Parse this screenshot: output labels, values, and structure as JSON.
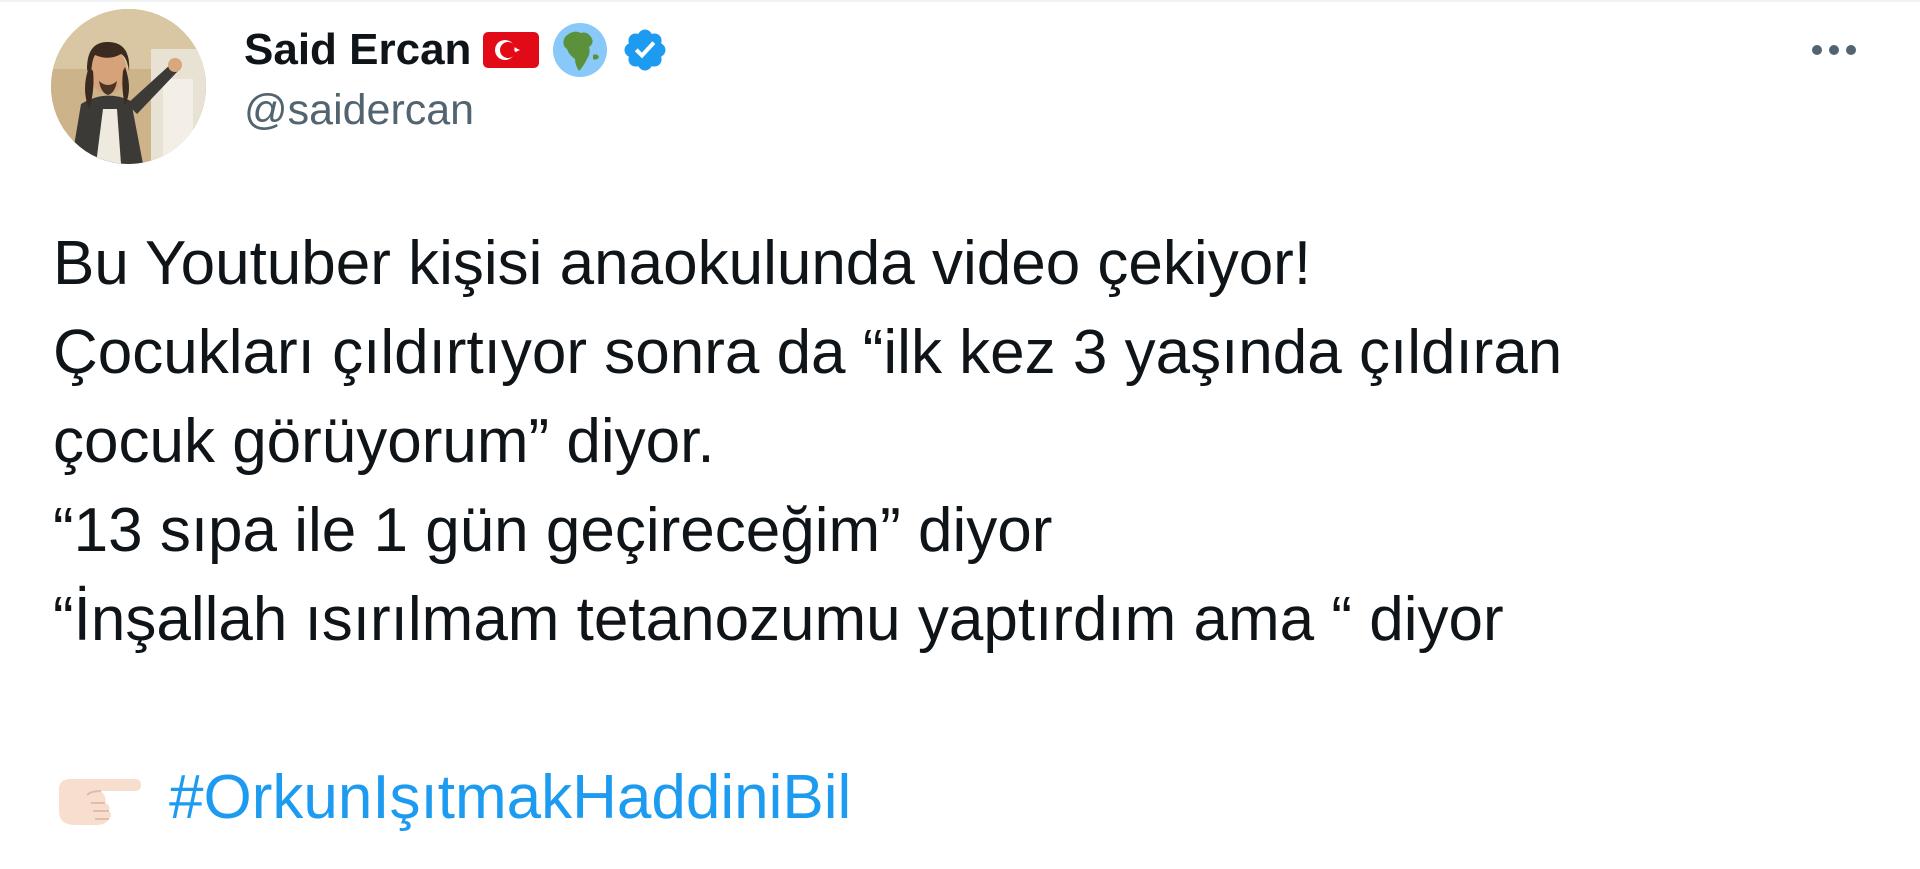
{
  "author": {
    "display_name": "Said Ercan",
    "handle": "@saidercan",
    "badges": [
      "turkey-flag-icon",
      "globe-africa-icon",
      "verified-badge-icon"
    ],
    "verified_color": "#1d9bf0"
  },
  "menu": {
    "more_icon": "more-horizontal-icon"
  },
  "tweet": {
    "lines": [
      "Bu Youtuber kişisi anaokulunda video çekiyor!",
      "Çocukları çıldırtıyor sonra da “ilk kez 3 yaşında çıldıran",
      "çocuk görüyorum” diyor.",
      "“13 sıpa ile 1 gün geçireceğim” diyor",
      "“İnşallah ısırılmam tetanozumu yaptırdım ama “ diyor"
    ],
    "pointer_emoji": "backhand-index-pointing-right-icon",
    "hashtag": "#OrkunIşıtmakHaddiniBil",
    "hashtag_color": "#1d9bf0",
    "text_color": "#0f1419"
  }
}
